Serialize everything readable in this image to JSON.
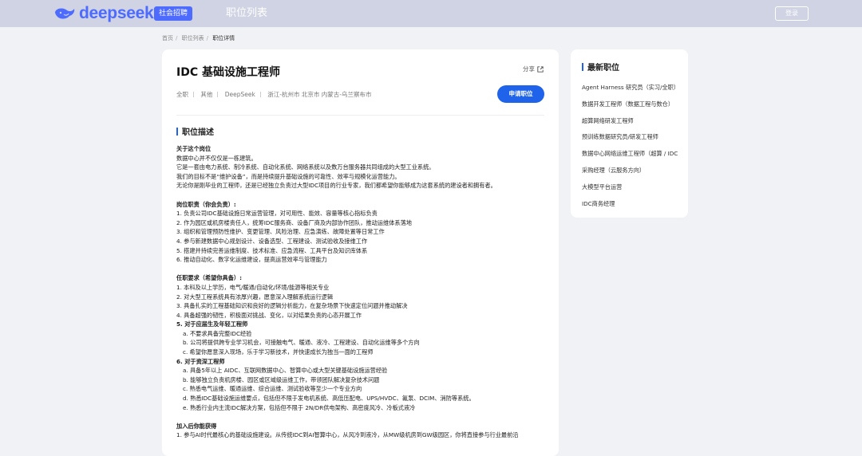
{
  "header": {
    "logo_text": "deepseek",
    "badge": "社会招聘",
    "nav_title": "职位列表",
    "login": "登录",
    "brand_color": "#4d6bfe"
  },
  "breadcrumb": [
    "首页",
    "职位列表",
    "职位详情"
  ],
  "job": {
    "title": "IDC 基础设施工程师",
    "share_label": "分享",
    "meta": [
      "全职",
      "其他",
      "DeepSeek",
      "浙江-杭州市 北京市 内蒙古-乌兰察布市"
    ],
    "apply_label": "申请职位",
    "section_title": "职位描述",
    "description": [
      {
        "t": "关于这个岗位",
        "s": "b"
      },
      {
        "t": "数据中心并不仅仅是一栋建筑。"
      },
      {
        "t": "它是一套由电力系统、制冷系统、自动化系统、网络系统以及数万台服务器共同组成的大型工业系统。"
      },
      {
        "t": "我们的目标不是“维护设备”，而是持续提升基础设施的可靠性、效率与规模化运营能力。"
      },
      {
        "t": "无论你是刚毕业的工程师，还是已经独立负责过大型IDC项目的行业专家，我们都希望你能够成为这套系统的建设者和拥有者。"
      },
      {
        "t": "",
        "s": "gap"
      },
      {
        "t": "岗位职责（你会负责）:",
        "s": "b"
      },
      {
        "t": "1. 负责公司IDC基础设施日常运营管理，对可用性、能效、容量等核心指标负责"
      },
      {
        "t": "2. 作为园区或机房楼责任人，统筹IDC服务商、设备厂商及内部协作团队，推动运维体系落地"
      },
      {
        "t": "3. 组织和管理预防性维护、变更管理、风险治理、应急演练、故障处置等日常工作"
      },
      {
        "t": "4. 参与新建数据中心规划设计、设备选型、工程建设、测试验收及接维工作"
      },
      {
        "t": "5. 搭建并持续完善运维制度、技术标准、应急流程、工具平台及知识库体系"
      },
      {
        "t": "6. 推动自动化、数字化运维建设，提高运营效率与管理能力"
      },
      {
        "t": "",
        "s": "gap"
      },
      {
        "t": "任职要求（希望你具备）:",
        "s": "b"
      },
      {
        "t": "1. 本科及以上学历，电气/暖通/自动化/环境/能源等相关专业"
      },
      {
        "t": "2. 对大型工程系统具有浓厚兴趣，愿意深入理解系统运行逻辑"
      },
      {
        "t": "3. 具备扎实的工程基础知识和良好的逻辑分析能力，在复杂场景下快速定位问题并推动解决"
      },
      {
        "t": "4. 具备超强的韧性，积极面对挑战、变化，以对结果负责的心态开展工作"
      },
      {
        "t": "5. 对于应届生及年轻工程师",
        "s": "b"
      },
      {
        "t": "a. 不要求具备完整IDC经验",
        "s": "ind"
      },
      {
        "t": "b. 公司将提供跨专业学习机会，可接触电气、暖通、液冷、工程建设、自动化运维等多个方向",
        "s": "ind"
      },
      {
        "t": "c. 希望你愿意深入现场，乐于学习新技术，并快速成长为独当一面的工程师",
        "s": "ind"
      },
      {
        "t": "6. 对于资深工程师",
        "s": "b"
      },
      {
        "t": "a. 具备5年以上 AIDC、互联网数据中心、智算中心或大型关键基础设施运营经验",
        "s": "ind"
      },
      {
        "t": "b. 能够独立负责机房楼、园区或区域级运维工作，带领团队解决复杂技术问题",
        "s": "ind"
      },
      {
        "t": "c. 熟悉电气运维、暖通运维、综合运维、测试验收等至少一个专业方向",
        "s": "ind"
      },
      {
        "t": "d. 熟悉IDC基础设施运维要点，包括但不限于发电机系统、高低压配电、UPS/HVDC、氟泵、DCIM、消防等系统。",
        "s": "ind"
      },
      {
        "t": "e. 熟悉行业内主流IDC解决方案，包括但不限于 2N/DR供电架构、高密度风冷、冷板式液冷",
        "s": "ind"
      },
      {
        "t": "",
        "s": "gap"
      },
      {
        "t": "加入后你能获得",
        "s": "b"
      },
      {
        "t": "1. 参与AI时代最核心的基础设施建设。从传统IDC到AI智算中心，从风冷到液冷，从MW级机房到GW级园区，你将直接参与行业最前沿"
      }
    ]
  },
  "sidebar": {
    "title": "最新职位",
    "items": [
      "Agent Harness 研究员（实习/全职）",
      "数据开发工程师（数据工程与数仓）",
      "超算网络研发工程师",
      "预训练数据研究员/研发工程师",
      "数据中心网络运维工程师（超算 / IDC）",
      "采购经理（云服务方向）",
      "大模型平台运营",
      "IDC商务经理"
    ]
  }
}
